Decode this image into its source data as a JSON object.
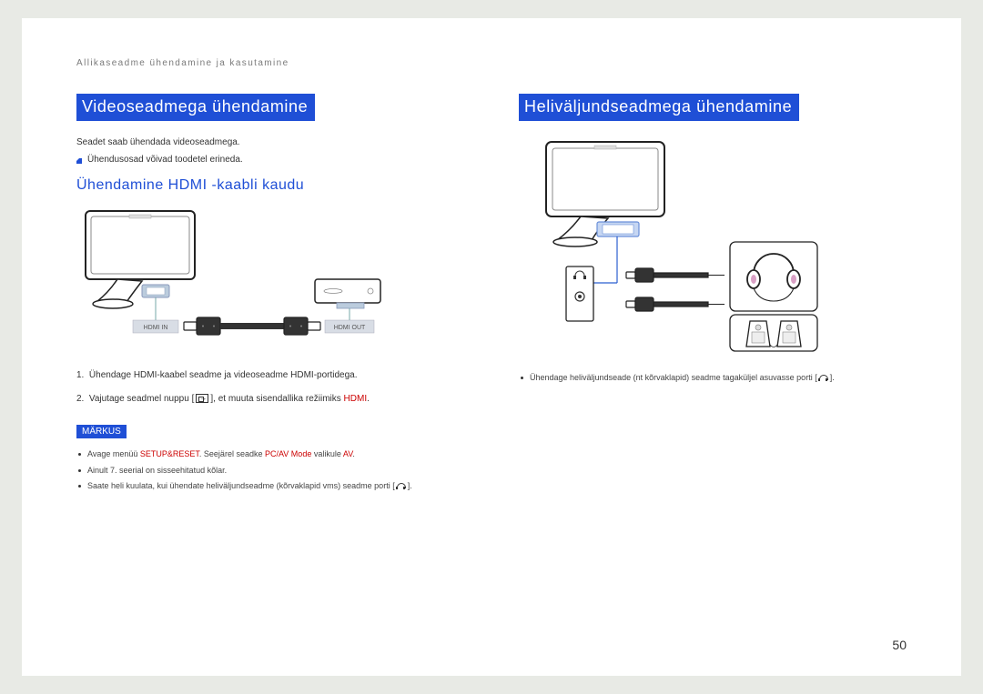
{
  "header": {
    "path": "Allikaseadme ühendamine ja kasutamine"
  },
  "left": {
    "heading": "Videoseadmega ühendamine",
    "intro": "Seadet saab ühendada videoseadmega.",
    "bullet": "Ühendusosad võivad toodetel erineda.",
    "subheading": "Ühendamine HDMI -kaabli kaudu",
    "ports": {
      "in": "HDMI IN",
      "out": "HDMI OUT"
    },
    "step1": "Ühendage HDMI-kaabel seadme ja videoseadme HDMI-portidega.",
    "step2a": "Vajutage seadmel nuppu [",
    "step2b": "], et muuta sisendallika režiimiks ",
    "step2c": "HDMI",
    "step2d": ".",
    "markus": "MÄRKUS",
    "notes": {
      "n1a": "Avage menüü ",
      "n1b": "SETUP&RESET",
      "n1c": ". Seejärel seadke ",
      "n1d": "PC/AV Mode",
      "n1e": " valikule ",
      "n1f": "AV",
      "n1g": ".",
      "n2": "Ainult 7. seerial on sisseehitatud kõlar.",
      "n3": "Saate heli kuulata, kui ühendate heliväljundseadme (kõrvaklapid vms) seadme porti ["
    }
  },
  "right": {
    "heading": "Heliväljundseadmega ühendamine",
    "note": "Ühendage heliväljundseade (nt kõrvaklapid) seadme tagaküljel asuvasse porti ["
  },
  "pageNumber": "50"
}
